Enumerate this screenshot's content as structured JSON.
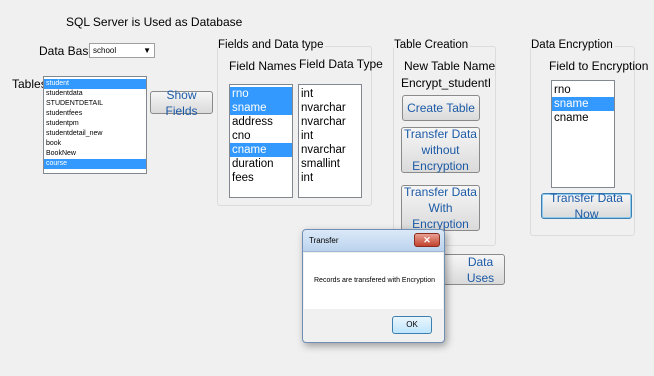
{
  "header": {
    "title": "SQL Server is Used as Database"
  },
  "database": {
    "label": "Data Bases",
    "selected": "school"
  },
  "tables": {
    "label": "Tables",
    "items": [
      "student",
      "studentdata",
      "STUDENTDETAIL",
      "studentfees",
      "studentpm",
      "studentdetail_new",
      "book",
      "BookNew",
      "course"
    ],
    "selected": [
      0,
      8
    ]
  },
  "show_fields_button": "Show Fields",
  "fields_group": {
    "title": "Fields and Data type",
    "names_header": "Field Names",
    "types_header": "Field Data Type",
    "names": [
      "rno",
      "sname",
      "address",
      "cno",
      "cname",
      "duration",
      "fees"
    ],
    "types": [
      "int",
      "nvarchar",
      "nvarchar",
      "int",
      "nvarchar",
      "smallint",
      "int"
    ],
    "selected_names": [
      0,
      1,
      4
    ]
  },
  "table_creation": {
    "title": "Table Creation",
    "new_name_label": "New Table Name",
    "new_name_value": "Encrypt_studentI",
    "create_button": "Create Table",
    "transfer_without_button": "Transfer Data\nwithout  Encryption",
    "transfer_with_button": "Transfer Data With\nEncryption",
    "data_uses_button": "Data Uses"
  },
  "encryption": {
    "title": "Data Encryption",
    "fields_label": "Field to Encryption",
    "fields": [
      "rno",
      "sname",
      "cname"
    ],
    "selected": [
      1
    ],
    "transfer_button": "Transfer Data Now"
  },
  "dialog": {
    "title": "Transfer",
    "close_icon": "close-icon",
    "message": "Records are transfered with Encryption",
    "ok_button": "OK"
  },
  "colors": {
    "selection": "#3399ff",
    "button_text": "#1c5aa6"
  }
}
